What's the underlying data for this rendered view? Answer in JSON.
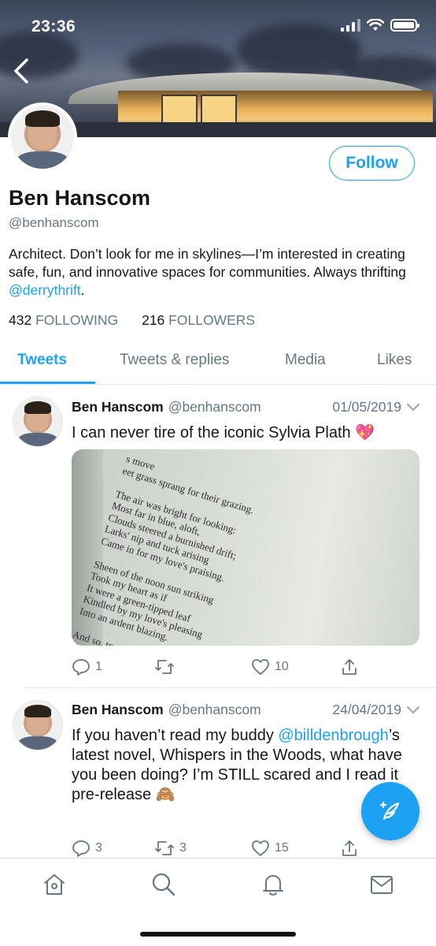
{
  "status_bar": {
    "time": "23:36"
  },
  "profile": {
    "name": "Ben Hanscom",
    "handle": "@benhanscom",
    "follow_label": "Follow",
    "bio_text": "Architect. Don’t look for me in skylines—I’m interested in creating safe, fun, and innovative spaces for communities. Always thrifting ",
    "bio_link": "@derrythrift",
    "bio_end": ".",
    "following_count": "432",
    "following_label": "FOLLOWING",
    "followers_count": "216",
    "followers_label": "FOLLOWERS"
  },
  "tabs": [
    {
      "label": "Tweets",
      "active": true
    },
    {
      "label": "Tweets & replies",
      "active": false
    },
    {
      "label": "Media",
      "active": false
    },
    {
      "label": "Likes",
      "active": false
    }
  ],
  "tweets": [
    {
      "name": "Ben Hanscom",
      "handle": "@benhanscom",
      "date": "01/05/2019",
      "text": "I can never tire of the iconic Sylvia Plath 💖",
      "media_poem": "s move\neet grass sprang for their grazing.\n\nThe air was bright for looking:\nMost far in blue, aloft,\nClouds steered a burnished drift;\nLarks' nip and tuck arising\nCame in for my love's praising.\n\nSheen of the noon sun striking\nTook my heart as if\nIt were a green-tipped leaf\nKindled by my love's pleasing\nInto an ardent blazing.\n\nAnd so, together\nThrough",
      "replies": "1",
      "retweets": "",
      "likes": "10"
    },
    {
      "name": "Ben Hanscom",
      "handle": "@benhanscom",
      "date": "24/04/2019",
      "text_start": "If you haven’t read my buddy ",
      "text_link": "@billdenbrough",
      "text_end": "’s latest novel, Whispers in the Woods, what have you been doing? I’m STILL scared and I read it pre-release 🙈",
      "replies": "3",
      "retweets": "3",
      "likes": "15"
    }
  ],
  "icons": {
    "back": "chevron-left-icon",
    "compose": "compose-tweet-icon",
    "nav": [
      "home-icon",
      "search-icon",
      "notifications-icon",
      "messages-icon"
    ]
  },
  "colors": {
    "accent": "#1da1f2",
    "secondary_text": "#657786"
  }
}
